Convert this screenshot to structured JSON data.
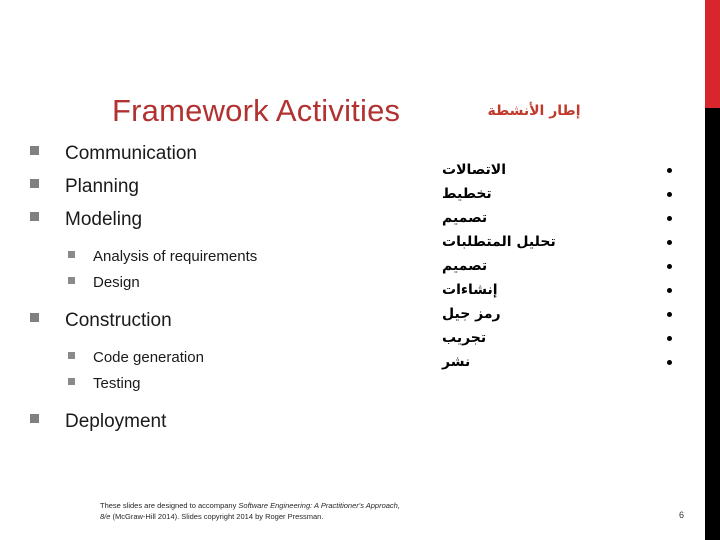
{
  "slide": {
    "title_en": "Framework Activities",
    "title_ar": "إطار الأنشطة",
    "page_number": "6",
    "accent_red": "#b23232",
    "bar_red": "#d8262c",
    "bar_black": "#000000",
    "bullet_gray": "#808080"
  },
  "outline": {
    "items": [
      {
        "level": 1,
        "label": "Communication"
      },
      {
        "level": 1,
        "label": "Planning"
      },
      {
        "level": 1,
        "label": "Modeling"
      },
      {
        "level": 2,
        "label": "Analysis of requirements"
      },
      {
        "level": 2,
        "label": "Design"
      },
      {
        "level": 1,
        "label": "Construction"
      },
      {
        "level": 2,
        "label": "Code generation"
      },
      {
        "level": 2,
        "label": "Testing"
      },
      {
        "level": 1,
        "label": "Deployment"
      }
    ]
  },
  "arabic_list": {
    "items": [
      {
        "label": "الاتصالات"
      },
      {
        "label": "تخطيط"
      },
      {
        "label": "تصميم"
      },
      {
        "label": "تحليل المتطلبات"
      },
      {
        "label": "تصميم"
      },
      {
        "label": "إنشاءات"
      },
      {
        "label": "رمز جيل"
      },
      {
        "label": "تجريب"
      },
      {
        "label": "نشر"
      }
    ]
  },
  "footer": {
    "line1_pre": "These slides are designed to accompany ",
    "line1_italic": "Software Engineering: A Practitioner's Approach,",
    "line2_italic": "8/e",
    "line2_post": " (McGraw-Hill 2014). Slides copyright 2014 by Roger Pressman."
  }
}
